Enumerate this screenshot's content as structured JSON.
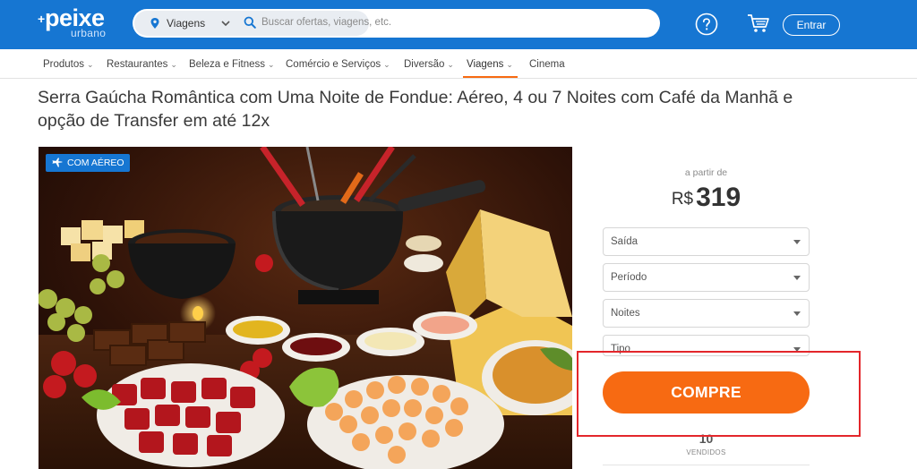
{
  "header": {
    "logo_main": "peixe",
    "logo_sub": "urbano",
    "category": "Viagens",
    "search_placeholder": "Buscar ofertas, viagens, etc.",
    "login_label": "Entrar",
    "brand_color": "#1676d2"
  },
  "nav": {
    "items": [
      {
        "label": "Produtos",
        "has_dropdown": true
      },
      {
        "label": "Restaurantes",
        "has_dropdown": true
      },
      {
        "label": "Beleza e Fitness",
        "has_dropdown": true
      },
      {
        "label": "Comércio e Serviços",
        "has_dropdown": true
      },
      {
        "label": "Diversão",
        "has_dropdown": true
      },
      {
        "label": "Viagens",
        "has_dropdown": true,
        "active": true
      },
      {
        "label": "Cinema",
        "has_dropdown": false
      }
    ],
    "chevron": "⌄",
    "active_color": "#f76a12"
  },
  "deal": {
    "title": "Serra Gaúcha Romântica com Uma Noite de Fondue: Aéreo, 4 ou 7 Noites com Café da Manhã e opção de Transfer em até 12x",
    "badge": "COM AÉREO"
  },
  "purchase": {
    "from_label": "a partir de",
    "currency": "R$",
    "price": "319",
    "selects": [
      "Saída",
      "Período",
      "Noites",
      "Tipo"
    ],
    "buy_label": "COMPRE",
    "buy_color": "#f76a12",
    "sold_count": "10",
    "sold_label": "VENDIDOS"
  },
  "annotation": {
    "highlight_color": "#e3262b"
  }
}
